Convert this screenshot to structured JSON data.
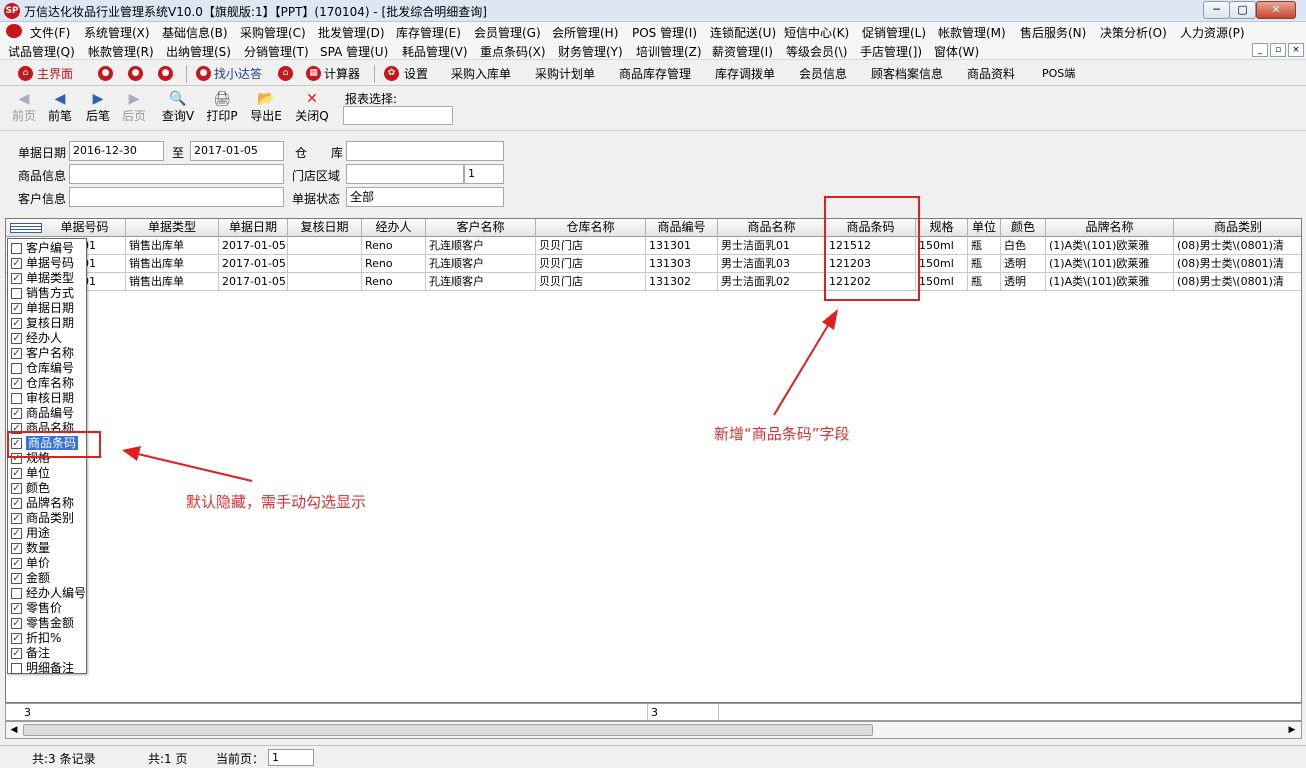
{
  "window": {
    "logo": "SP",
    "title": "万信达化妆品行业管理系统V10.0【旗舰版:1】【PPT】(170104) - [批发综合明细查询]",
    "min": "─",
    "restore": "▢",
    "close": "✕"
  },
  "menu_row1": [
    "文件(F)",
    "系统管理(X)",
    "基础信息(B)",
    "采购管理(C)",
    "批发管理(D)",
    "库存管理(E)",
    "会员管理(G)",
    "会所管理(H)",
    "POS 管理(I)",
    "连锁配送(U)",
    "短信中心(K)",
    "促销管理(L)",
    "帐款管理(M)",
    "售后服务(N)",
    "决策分析(O)",
    "人力资源(P)"
  ],
  "menu_row2": [
    "试品管理(Q)",
    "帐款管理(R)",
    "出纳管理(S)",
    "分销管理(T)",
    "SPA 管理(U)",
    "耗品管理(V)",
    "重点条码(X)",
    "财务管理(Y)",
    "培训管理(Z)",
    "薪资管理(I)",
    "等级会员(\\)",
    "手店管理(])",
    "窗体(W)"
  ],
  "mdi": {
    "min": "_",
    "restore": "▫",
    "close": "×"
  },
  "quickbar": {
    "home": "主界面",
    "find": "找小达答",
    "calc": "计算器",
    "settings": "设置",
    "links": [
      "采购入库单",
      "采购计划单",
      "商品库存管理",
      "库存调拨单",
      "会员信息",
      "顾客档案信息",
      "商品资料",
      "POS端"
    ]
  },
  "actions": [
    {
      "label": "前页",
      "icon": "◀",
      "disabled": true
    },
    {
      "label": "前笔",
      "icon": "◀",
      "disabled": false
    },
    {
      "label": "后笔",
      "icon": "▶",
      "disabled": false
    },
    {
      "label": "后页",
      "icon": "▶",
      "disabled": true
    },
    {
      "label": "查询V",
      "icon": "🔍",
      "disabled": false
    },
    {
      "label": "打印P",
      "icon": "🖨",
      "disabled": false
    },
    {
      "label": "导出E",
      "icon": "📂",
      "disabled": false
    },
    {
      "label": "关闭Q",
      "icon": "✕",
      "disabled": false
    }
  ],
  "report_select_label": "报表选择:",
  "filters": {
    "date_label": "单据日期",
    "date_from": "2016-12-30",
    "to_label": "至",
    "date_to": "2017-01-05",
    "warehouse_label": "仓　　库",
    "product_label": "商品信息",
    "store_label": "门店区域",
    "store_value": "1",
    "customer_label": "客户信息",
    "status_label": "单据状态",
    "status_value": "全部"
  },
  "grid": {
    "headers": [
      "单据号码",
      "单据类型",
      "单据日期",
      "复核日期",
      "经办人",
      "客户名称",
      "仓库名称",
      "商品编号",
      "商品名称",
      "商品条码",
      "规格",
      "单位",
      "颜色",
      "品牌名称",
      "商品类别"
    ],
    "rows": [
      [
        "0000001",
        "销售出库单",
        "2017-01-05",
        "",
        "Reno",
        "孔连顺客户",
        "贝贝门店",
        "131301",
        "男士洁面乳01",
        "121512",
        "150ml",
        "瓶",
        "白色",
        "(1)A类\\(101)欧莱雅",
        "(08)男士类\\(0801)清"
      ],
      [
        "0000001",
        "销售出库单",
        "2017-01-05",
        "",
        "Reno",
        "孔连顺客户",
        "贝贝门店",
        "131303",
        "男士洁面乳03",
        "121203",
        "150ml",
        "瓶",
        "透明",
        "(1)A类\\(101)欧莱雅",
        "(08)男士类\\(0801)清"
      ],
      [
        "0000001",
        "销售出库单",
        "2017-01-05",
        "",
        "Reno",
        "孔连顺客户",
        "贝贝门店",
        "131302",
        "男士洁面乳02",
        "121202",
        "150ml",
        "瓶",
        "透明",
        "(1)A类\\(101)欧莱雅",
        "(08)男士类\\(0801)清"
      ]
    ]
  },
  "column_chooser": [
    {
      "label": "客户编号",
      "checked": false
    },
    {
      "label": "单据号码",
      "checked": true
    },
    {
      "label": "单据类型",
      "checked": true
    },
    {
      "label": "销售方式",
      "checked": false
    },
    {
      "label": "单据日期",
      "checked": true
    },
    {
      "label": "复核日期",
      "checked": true
    },
    {
      "label": "经办人",
      "checked": true
    },
    {
      "label": "客户名称",
      "checked": true
    },
    {
      "label": "仓库编号",
      "checked": false
    },
    {
      "label": "仓库名称",
      "checked": true
    },
    {
      "label": "审核日期",
      "checked": false
    },
    {
      "label": "商品编号",
      "checked": true
    },
    {
      "label": "商品名称",
      "checked": true
    },
    {
      "label": "商品条码",
      "checked": true,
      "selected": true
    },
    {
      "label": "规格",
      "checked": true
    },
    {
      "label": "单位",
      "checked": true
    },
    {
      "label": "颜色",
      "checked": true
    },
    {
      "label": "品牌名称",
      "checked": true
    },
    {
      "label": "商品类别",
      "checked": true
    },
    {
      "label": "用途",
      "checked": true
    },
    {
      "label": "数量",
      "checked": true
    },
    {
      "label": "单价",
      "checked": true
    },
    {
      "label": "金额",
      "checked": true
    },
    {
      "label": "经办人编号",
      "checked": false
    },
    {
      "label": "零售价",
      "checked": true
    },
    {
      "label": "零售金额",
      "checked": true
    },
    {
      "label": "折扣%",
      "checked": true
    },
    {
      "label": "备注",
      "checked": true
    },
    {
      "label": "明细备注",
      "checked": false
    }
  ],
  "annotations": {
    "new_field": "新增“商品条码”字段",
    "hidden_note": "默认隐藏，需手动勾选显示",
    "color": "#e02020"
  },
  "summary": {
    "count_left": "3",
    "count_right": "3"
  },
  "status": {
    "records": "共:3 条记录",
    "pages": "共:1 页",
    "current_label": "当前页：",
    "current_value": "1"
  }
}
